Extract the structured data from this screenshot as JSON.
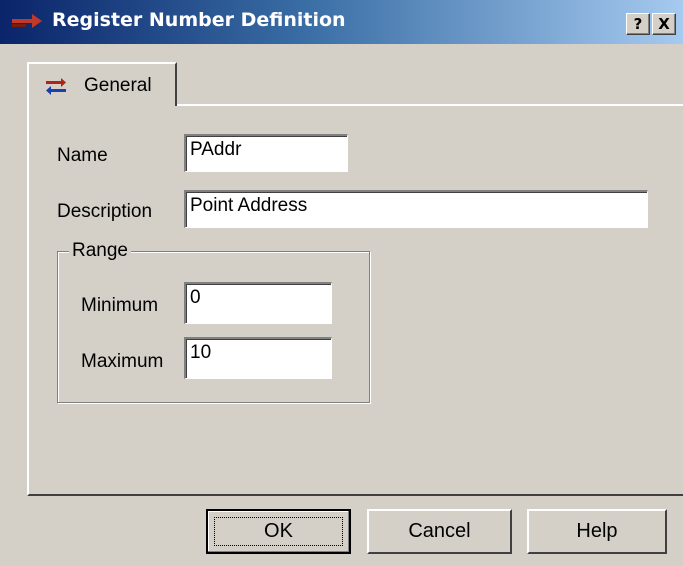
{
  "window": {
    "title": "Register Number Definition",
    "help_button": "?",
    "close_button": "X"
  },
  "tabs": [
    {
      "label": "General",
      "selected": true
    }
  ],
  "form": {
    "name_label": "Name",
    "name_value": "PAddr",
    "description_label": "Description",
    "description_value": "Point Address",
    "range": {
      "legend": "Range",
      "minimum_label": "Minimum",
      "minimum_value": "0",
      "maximum_label": "Maximum",
      "maximum_value": "10"
    }
  },
  "buttons": {
    "ok": "OK",
    "cancel": "Cancel",
    "help": "Help"
  },
  "colors": {
    "titlebar_start": "#0a246a",
    "titlebar_end": "#a6caf0",
    "face": "#d4d0c8"
  }
}
